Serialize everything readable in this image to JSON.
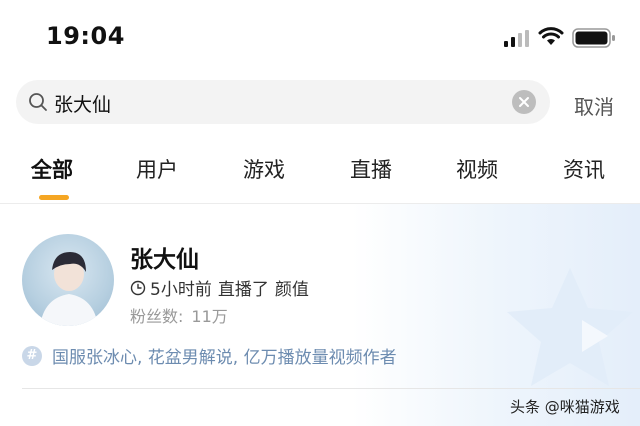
{
  "status_bar": {
    "time": "19:04"
  },
  "search": {
    "query": "张大仙",
    "cancel_label": "取消"
  },
  "tabs": [
    {
      "label": "全部",
      "active": true
    },
    {
      "label": "用户",
      "active": false
    },
    {
      "label": "游戏",
      "active": false
    },
    {
      "label": "直播",
      "active": false
    },
    {
      "label": "视频",
      "active": false
    },
    {
      "label": "资讯",
      "active": false
    }
  ],
  "result": {
    "name": "张大仙",
    "time_ago": "5小时前",
    "status": "直播了",
    "category": "颜值",
    "fans_label": "粉丝数:",
    "fans_count": "11万",
    "description": "国服张冰心, 花盆男解说, 亿万播放量视频作者"
  },
  "watermark": "头条 @咪猫游戏",
  "colors": {
    "accent": "#f5a623",
    "tag": "#6d8cb0"
  }
}
